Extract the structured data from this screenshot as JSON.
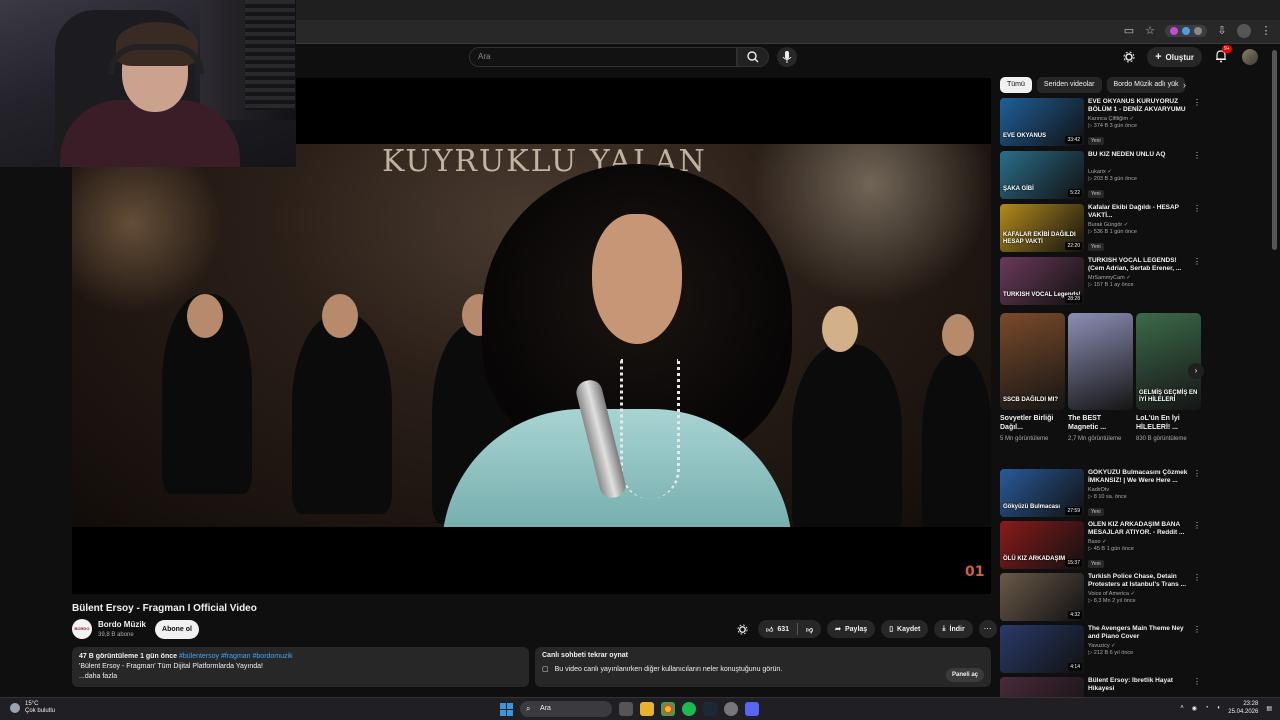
{
  "header": {
    "search_placeholder": "Ara",
    "create_label": "Oluştur",
    "notif_count": "9+"
  },
  "video": {
    "title": "Bülent Ersoy - Fragman I Official Video",
    "frame_text": "KUYRUKLU YALAN",
    "watermark": "01"
  },
  "channel": {
    "avatar_text": "BORDO MÜZİK",
    "name": "Bordo Müzik",
    "subs": "39,8 B abone",
    "subscribe_label": "Abone ol"
  },
  "actions": {
    "likes": "631",
    "share": "Paylaş",
    "save": "Kaydet",
    "download": "İndir"
  },
  "description": {
    "stats": "47 B görüntüleme  1 gün önce",
    "tags": "#bülentersoy #fragman #bordomuzik",
    "line": "'Bülent Ersoy - Fragman' Tüm Dijital Platformlarda Yayında!",
    "more": "...daha fazla"
  },
  "live_chat": {
    "title": "Canlı sohbeti tekrar oynat",
    "text": "Bu video canlı yayınlanırken diğer kullanıcıların neler konuştuğunu görün.",
    "button": "Paneli aç"
  },
  "chips": [
    "Tümü",
    "Seriden videolar",
    "Bordo Müzik adlı yük"
  ],
  "recs_top": [
    {
      "title": "EVE OKYANUS KURUYORUZ BÖLÜM 1 - DENİZ AKVARYUMU",
      "channel": "Karınca Çiftliğim ✓",
      "meta": "▷ 374 B  3 gün önce",
      "badge": "Yeni",
      "duration": "33:42",
      "thumb_text": "EVE OKYANUS",
      "color": "#1f5f9a"
    },
    {
      "title": "BU KIZ NEDEN ÜNLÜ AQ",
      "channel": "Lukarix ✓",
      "meta": "▷ 203 B  3 gün önce",
      "badge": "Yeni",
      "duration": "5:22",
      "thumb_text": "ŞAKA GİBİ",
      "color": "#2a6e8a"
    },
    {
      "title": "Kafalar Ekibi Dağıldı - HESAP VAKTİ...",
      "channel": "Burak Güngör ✓",
      "meta": "▷ 536 B  1 gün önce",
      "badge": "Yeni",
      "duration": "22:20",
      "thumb_text": "KAFALAR EKİBİ DAĞILDI HESAP VAKTİ",
      "color": "#b38a1c"
    },
    {
      "title": "TURKISH VOCAL LEGENDS! (Cem Adrian, Sertab Erener, ...",
      "channel": "MrSammyCam ✓",
      "meta": "▷ 157 B  1 ay önce",
      "badge": "",
      "duration": "28:28",
      "thumb_text": "TURKISH VOCAL Legends!",
      "color": "#6a3a5a"
    }
  ],
  "shorts": [
    {
      "title": "Sovyetler Birliği Dağıl...",
      "views": "5 Mn görüntüleme",
      "thumb_text": "SSCB DAĞILDI MI?",
      "color": "#7a4a2a"
    },
    {
      "title": "The BEST Magnetic ...",
      "views": "2,7 Mn görüntüleme",
      "thumb_text": "",
      "color": "#8c8fb5"
    },
    {
      "title": "LoL'ün En İyi HİLELERİ! ...",
      "views": "830 B görüntüleme",
      "thumb_text": "GELMİŞ GEÇMİŞ EN İYİ HİLELERİ",
      "color": "#3c6a4a"
    }
  ],
  "recs_bottom": [
    {
      "title": "GÖKYÜZÜ Bulmacasını Çözmek İMKANSIZ! | We Were Here ...",
      "channel": "KadirDtv",
      "meta": "▷ 8  10 sa. önce",
      "badge": "Yeni",
      "duration": "27:59",
      "thumb_text": "Gökyüzü Bulmacası",
      "color": "#2a5a9a"
    },
    {
      "title": "ÖLEN KIZ ARKADAŞIM BANA MESAJLAR ATIYOR. - Reddit ...",
      "channel": "Baso ✓",
      "meta": "▷ 45 B  1 gün önce",
      "badge": "Yeni",
      "duration": "15:37",
      "thumb_text": "ÖLÜ KIZ ARKADAŞIM",
      "color": "#8a1a1a"
    },
    {
      "title": "Turkish Police Chase, Detain Protesters at Istanbul's Trans ...",
      "channel": "Voice of America ✓",
      "meta": "▷ 8,3 Mn  2 yıl önce",
      "badge": "",
      "duration": "4:32",
      "thumb_text": "",
      "color": "#6a5a4a"
    },
    {
      "title": "The Avengers Main Theme Ney and Piano Cover",
      "channel": "Yavuzicy ✓",
      "meta": "▷ 212 B  6 yıl önce",
      "badge": "",
      "duration": "4:14",
      "thumb_text": "",
      "color": "#2a3a6a"
    },
    {
      "title": "Bülent Ersoy: İbretlik Hayat Hikayesi",
      "channel": "",
      "meta": "",
      "badge": "",
      "duration": "",
      "thumb_text": "",
      "color": "#4a2a3a"
    }
  ],
  "taskbar": {
    "temp": "15°C",
    "weather": "Çok bulutlu",
    "search": "Ara",
    "time": "23:28",
    "date": "25.04.2026"
  }
}
